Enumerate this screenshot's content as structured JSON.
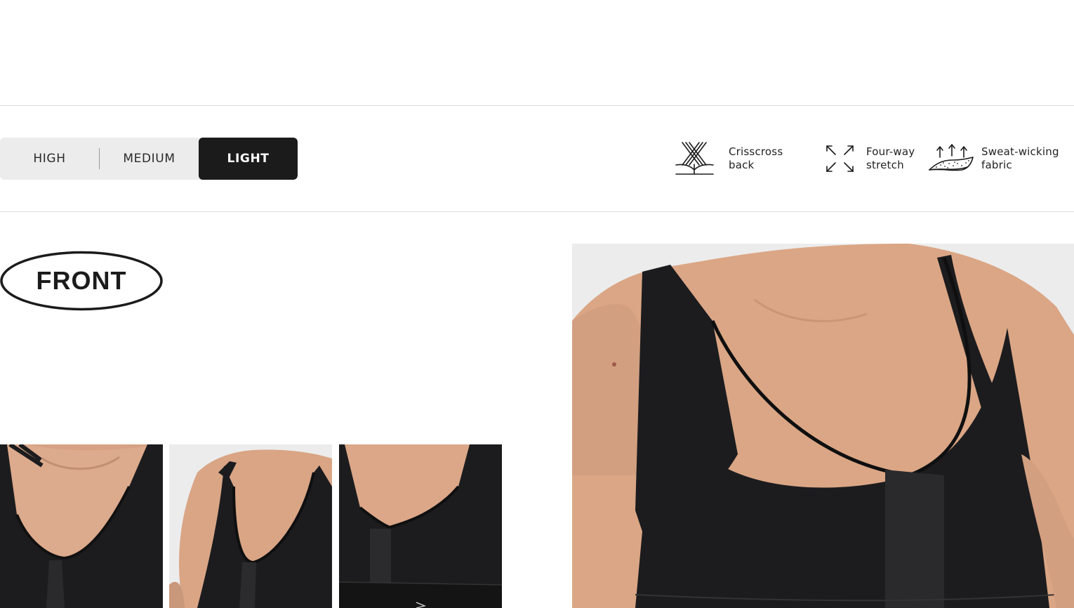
{
  "support_level": {
    "options": [
      {
        "label": "HIGH",
        "active": false
      },
      {
        "label": "MEDIUM",
        "active": false
      },
      {
        "label": "LIGHT",
        "active": true
      }
    ]
  },
  "features": [
    {
      "icon": "crisscross-back-icon",
      "line1": "Crisscross",
      "line2": "back"
    },
    {
      "icon": "four-way-stretch-icon",
      "line1": "Four-way",
      "line2": "stretch"
    },
    {
      "icon": "sweat-wicking-icon",
      "line1": "Sweat-wicking",
      "line2": "fabric"
    }
  ],
  "view_badge": {
    "label": "FRONT"
  },
  "colors": {
    "accent": "#1b1b1b",
    "toggle_bg": "#ececec",
    "skin": "#d9a98a",
    "garment": "#1c1c1e",
    "photo_bg": "#e9e9e9"
  }
}
